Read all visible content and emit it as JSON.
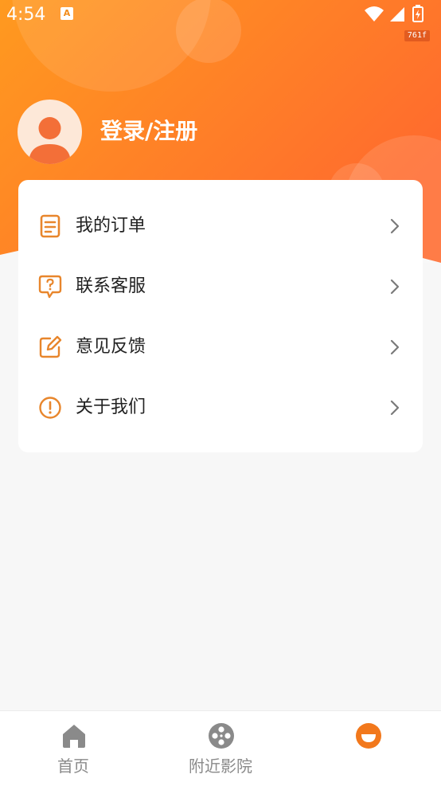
{
  "status_bar": {
    "time": "4:54",
    "notification_glyph": "A",
    "badge": "761f",
    "icons": [
      "wifi-icon",
      "signal-icon",
      "battery-charging-icon"
    ]
  },
  "theme": {
    "accent": "#f28c1a",
    "gradient_start": "#ff9a1f",
    "gradient_end": "#ff6a2e",
    "background": "#f7f7f7"
  },
  "profile": {
    "login_label": "登录/注册",
    "avatar_icon": "default-avatar-icon"
  },
  "menu": {
    "items": [
      {
        "label": "我的订单",
        "icon": "order-list-icon"
      },
      {
        "label": "联系客服",
        "icon": "customer-service-icon"
      },
      {
        "label": "意见反馈",
        "icon": "feedback-edit-icon"
      },
      {
        "label": "关于我们",
        "icon": "info-exclamation-icon"
      }
    ]
  },
  "tabbar": {
    "tabs": [
      {
        "label": "首页",
        "icon": "home-icon",
        "active": false
      },
      {
        "label": "附近影院",
        "icon": "film-reel-icon",
        "active": false
      },
      {
        "label": "",
        "icon": "profile-smile-icon",
        "active": true
      }
    ]
  }
}
